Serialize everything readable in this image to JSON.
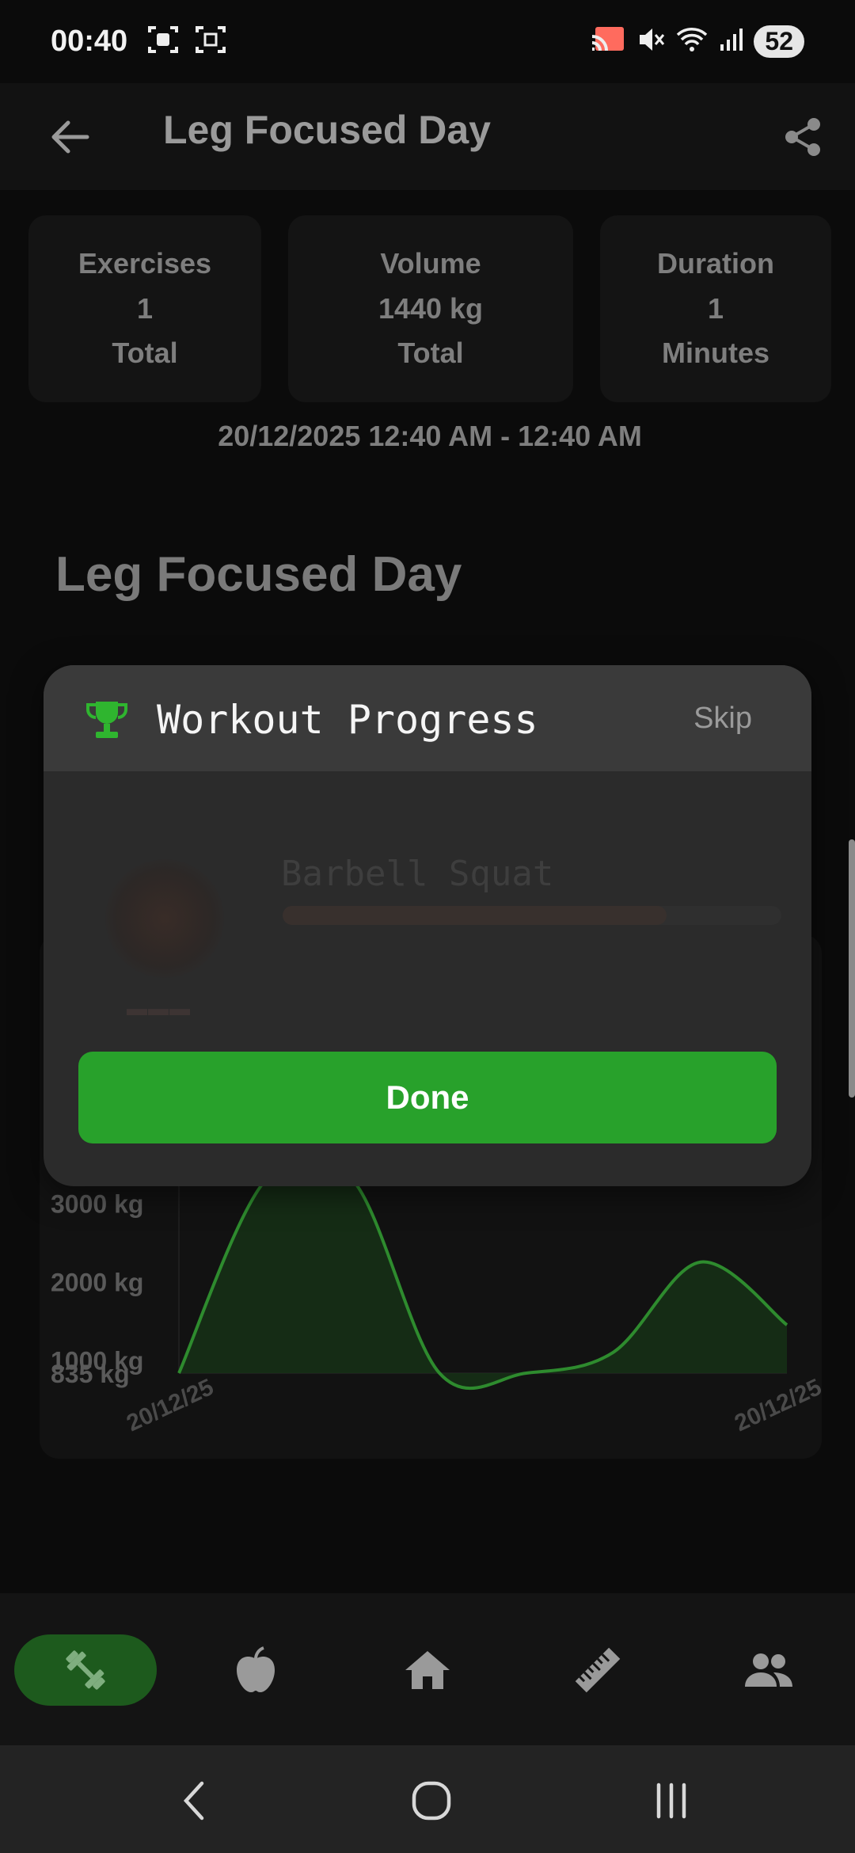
{
  "status_bar": {
    "time": "00:40",
    "battery": "52"
  },
  "app_bar": {
    "title": "Leg Focused Day"
  },
  "stats": [
    {
      "label": "Exercises",
      "value": "1",
      "unit": "Total"
    },
    {
      "label": "Volume",
      "value": "1440 kg",
      "unit": "Total"
    },
    {
      "label": "Duration",
      "value": "1",
      "unit": "Minutes"
    }
  ],
  "date_range": "20/12/2025 12:40 AM - 12:40 AM",
  "section_title": "Leg Focused Day",
  "modal": {
    "title": "Workout Progress",
    "skip_label": "Skip",
    "exercise_name": "Barbell Squat",
    "progress": 0.77,
    "done_label": "Done"
  },
  "chart_data": {
    "type": "area",
    "x": [
      "20/12/25",
      "",
      "",
      "",
      "",
      "",
      "",
      "20/12/25"
    ],
    "values": [
      835,
      3300,
      3300,
      835,
      835,
      1100,
      2250,
      1450
    ],
    "y_tick_labels": [
      "3000 kg",
      "2000 kg",
      "1000 kg",
      "835 kg"
    ],
    "y_ticks": [
      3000,
      2000,
      1000,
      835
    ],
    "ylim": [
      835,
      3400
    ],
    "x_tick_labels": [
      "20/12/25",
      "20/12/25"
    ],
    "line_color": "#2e8b2e",
    "fill_color": "#163016"
  },
  "bottom_nav": [
    {
      "icon": "dumbbell-icon",
      "active": true
    },
    {
      "icon": "apple-icon",
      "active": false
    },
    {
      "icon": "home-icon",
      "active": false
    },
    {
      "icon": "ruler-icon",
      "active": false
    },
    {
      "icon": "people-icon",
      "active": false
    }
  ],
  "colors": {
    "accent": "#28a12b",
    "background": "#0b0b0b",
    "modal": "#2b2b2b"
  }
}
